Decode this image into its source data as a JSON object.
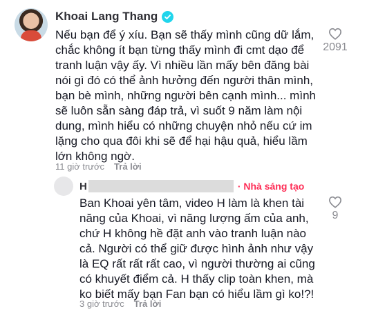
{
  "main_comment": {
    "username": "Khoai Lang Thang",
    "text": "Nếu bạn để ý xíu. Bạn sẽ thấy mình cũng dữ lắm, chắc không ít bạn từng thấy mình đi cmt dạo để tranh luận vậy ấy. Vì nhiều lần mấy bên đăng bài nói gì đó có thể ảnh hưởng đến người thân mình, bạn bè mình, những người bên cạnh mình... mình sẽ luôn sẵn sàng đáp trả, vì suốt 9 năm làm nội dung, mình hiểu có những chuyện nhỏ nếu cứ im lặng cho qua đôi khi sẽ để hại hậu quả, hiểu lầm lớn không ngờ.",
    "time": "11 giờ trước",
    "reply_label": "Trả lời",
    "likes": "2091"
  },
  "reply_comment": {
    "username_initial": "H",
    "creator_badge": "· Nhà sáng tạo",
    "text": "Ban Khoai yên tâm, video H làm là khen tài năng của Khoai, vì năng lượng ấm của anh, chứ H không hề đặt anh vào tranh luận nào cả. Người có thể giữ được hình ảnh như vậy là EQ rất rất rất cao, vì người thường ai cũng có khuyết điểm cả. H thấy clip toàn khen, mà ko biết mấy bạn Fan bạn có hiểu lầm gì ko!?!",
    "time": "3 giờ trước",
    "reply_label": "Trả lời",
    "likes": "9"
  }
}
